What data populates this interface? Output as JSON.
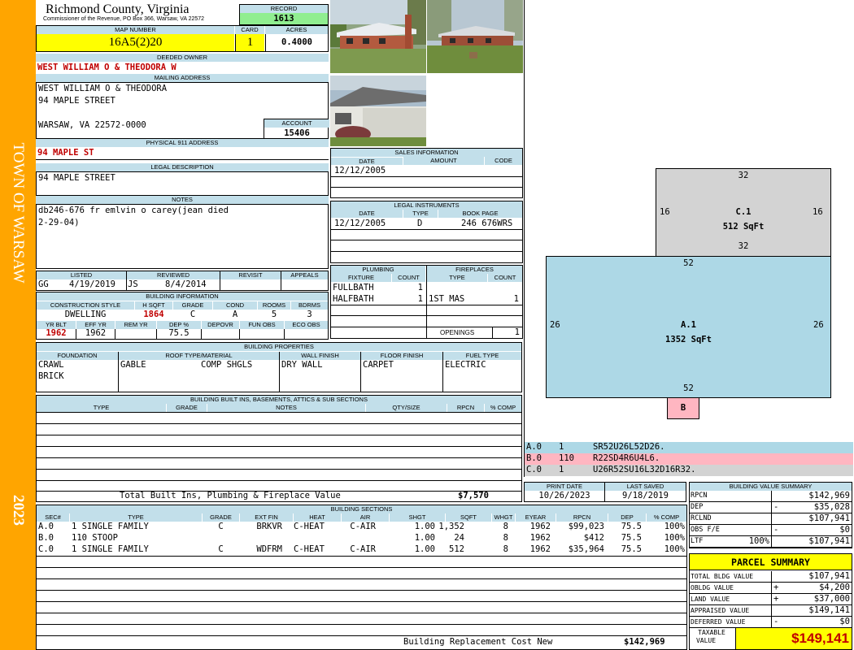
{
  "sidebar": {
    "town": "TOWN OF WARSAW",
    "year": "2023"
  },
  "header": {
    "county": "Richmond County, Virginia",
    "commissioner": "Commissioner of the Revenue, PO Box 366, Warsaw, VA 22572",
    "record_label": "RECORD",
    "record": "1613",
    "map_label": "MAP NUMBER",
    "map_number": "16A5(2)20",
    "card_label": "CARD",
    "card": "1",
    "acres_label": "ACRES",
    "acres": "0.4000"
  },
  "owner": {
    "deeded_label": "DEEDED OWNER",
    "deeded": "WEST WILLIAM O & THEODORA W",
    "mailing_label": "MAILING ADDRESS",
    "mail1": "WEST WILLIAM O & THEODORA",
    "mail2": "94 MAPLE STREET",
    "mail3": "WARSAW, VA 22572-0000",
    "account_label": "ACCOUNT",
    "account": "15406",
    "physical_label": "PHYSICAL 911 ADDRESS",
    "physical": "94 MAPLE ST",
    "legal_label": "LEGAL DESCRIPTION",
    "legal": "94 MAPLE STREET",
    "notes_label": "NOTES",
    "notes1": "db246-676 fr emlvin o carey(jean died",
    "notes2": "2-29-04)"
  },
  "review": {
    "listed_label": "LISTED",
    "reviewed_label": "REVIEWED",
    "revisit_label": "REVISIT",
    "appeals_label": "APPEALS",
    "listed_by": "GG",
    "listed_date": "4/19/2019",
    "reviewed_by": "JS",
    "reviewed_date": "8/4/2014"
  },
  "building_info": {
    "title": "BUILDING INFORMATION",
    "h": [
      "CONSTRUCTION STYLE",
      "H SQFT",
      "GRADE",
      "COND",
      "ROOMS",
      "BDRMS"
    ],
    "v": [
      "DWELLING",
      "1864",
      "C",
      "A",
      "5",
      "3"
    ],
    "h2": [
      "YR BLT",
      "EFF YR",
      "REM YR",
      "DEP %",
      "DEPOVR",
      "FUN OBS",
      "ECO OBS"
    ],
    "v2": [
      "1962",
      "1962",
      "",
      "75.5",
      "",
      "",
      ""
    ]
  },
  "sales": {
    "title": "SALES INFORMATION",
    "h": [
      "DATE",
      "AMOUNT",
      "CODE"
    ],
    "date": "12/12/2005"
  },
  "legal_instr": {
    "title": "LEGAL INSTRUMENTS",
    "h": [
      "DATE",
      "TYPE",
      "BOOK PAGE"
    ],
    "date": "12/12/2005",
    "type": "D",
    "book": "246 676WRS"
  },
  "plumbing": {
    "title": "PLUMBING",
    "h": [
      "FIXTURE",
      "COUNT"
    ],
    "r1": [
      "FULLBATH",
      "1"
    ],
    "r2": [
      "HALFBATH",
      "1"
    ]
  },
  "fireplaces": {
    "title": "FIREPLACES",
    "h": [
      "TYPE",
      "COUNT"
    ],
    "r1": [
      "1ST MAS",
      "1"
    ],
    "openings_label": "OPENINGS",
    "openings": "1"
  },
  "properties": {
    "title": "BUILDING PROPERTIES",
    "h": [
      "FOUNDATION",
      "ROOF TYPE/MATERIAL",
      "WALL FINISH",
      "FLOOR FINISH",
      "FUEL TYPE"
    ],
    "foundation1": "CRAWL",
    "foundation2": "BRICK",
    "roof_type": "GABLE",
    "roof_mat": "COMP SHGLS",
    "wall": "DRY WALL",
    "floor": "CARPET",
    "fuel": "ELECTRIC"
  },
  "builtins": {
    "title": "BUILDING BUILT INS, BASEMENTS, ATTICS & SUB SECTIONS",
    "h": [
      "TYPE",
      "GRADE",
      "NOTES",
      "QTY/SIZE",
      "RPCN",
      "% COMP"
    ],
    "total_label": "Total Built Ins, Plumbing & Fireplace Value",
    "total": "$7,570"
  },
  "print": {
    "print_label": "PRINT DATE",
    "saved_label": "LAST SAVED",
    "print_date": "10/26/2023",
    "saved_date": "9/18/2019"
  },
  "sections": {
    "title": "BUILDING SECTIONS",
    "h": [
      "SEC#",
      "TYPE",
      "GRADE",
      "EXT FIN",
      "HEAT",
      "AIR",
      "SHGT",
      "SQFT",
      "WHGT",
      "EYEAR",
      "RPCN",
      "DEP",
      "% COMP"
    ],
    "rows": [
      [
        "A.0",
        "1 SINGLE FAMILY",
        "C",
        "BRKVR",
        "C-HEAT",
        "C-AIR",
        "1.00",
        "1,352",
        "8",
        "1962",
        "$99,023",
        "75.5",
        "100%"
      ],
      [
        "B.0",
        "110 STOOP",
        "",
        "",
        "",
        "",
        "1.00",
        "24",
        "8",
        "1962",
        "$412",
        "75.5",
        "100%"
      ],
      [
        "C.0",
        "1 SINGLE FAMILY",
        "C",
        "WDFRM",
        "C-HEAT",
        "C-AIR",
        "1.00",
        "512",
        "8",
        "1962",
        "$35,964",
        "75.5",
        "100%"
      ]
    ],
    "rcn_label": "Building Replacement Cost New",
    "rcn": "$142,969"
  },
  "sketch": {
    "c": {
      "label": "C.1",
      "area": "512 SqFt",
      "top": "32",
      "bottom": "32",
      "left": "16",
      "right": "16"
    },
    "a": {
      "label": "A.1",
      "area": "1352 SqFt",
      "top": "52",
      "bottom": "52",
      "left": "26",
      "right": "26"
    },
    "b": {
      "label": "B"
    },
    "legend": [
      [
        "A.0",
        "1",
        "SR52U26L52D26."
      ],
      [
        "B.0",
        "110",
        "R22SD4R6U4L6."
      ],
      [
        "C.0",
        "1",
        "U26R52SU16L32D16R32."
      ]
    ]
  },
  "bvs": {
    "title": "BUILDING VALUE SUMMARY",
    "rows": [
      [
        "RPCN",
        "",
        "$142,969"
      ],
      [
        "DEP",
        "-",
        "$35,028"
      ],
      [
        "RCLND",
        "",
        "$107,941"
      ],
      [
        "OBS F/E",
        "-",
        "$0"
      ],
      [
        "LTF",
        "100%",
        "$107,941"
      ]
    ]
  },
  "parcel": {
    "title": "PARCEL SUMMARY",
    "rows": [
      [
        "TOTAL BLDG VALUE",
        "",
        "$107,941"
      ],
      [
        "OBLDG VALUE",
        "+",
        "$4,200"
      ],
      [
        "LAND VALUE",
        "+",
        "$37,000"
      ],
      [
        "APPRAISED VALUE",
        "",
        "$149,141"
      ],
      [
        "DEFERRED VALUE",
        "-",
        "$0"
      ]
    ],
    "taxable_label1": "TAXABLE",
    "taxable_label2": "VALUE",
    "taxable": "$149,141"
  },
  "colors": {
    "sidebar": "#ffa500",
    "header_band": "#c2dfea",
    "yellow": "#ffff00",
    "green": "#90ee90",
    "red_text": "#c00000",
    "sketch_a": "#add8e6",
    "sketch_c": "#d3d3d3",
    "sketch_b": "#ffb6c1"
  }
}
